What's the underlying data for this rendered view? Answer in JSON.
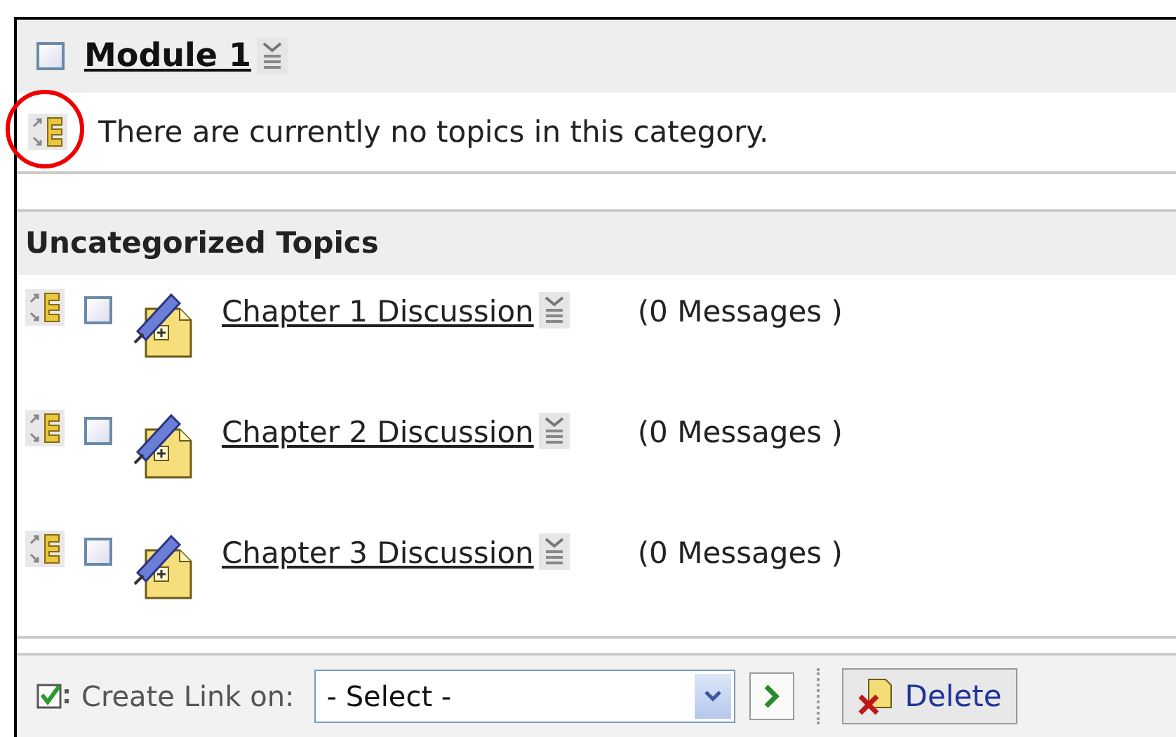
{
  "category": {
    "title": "Module 1",
    "checked": false,
    "empty_message": "There are currently no topics in this category."
  },
  "uncategorized": {
    "heading": "Uncategorized Topics",
    "topics": [
      {
        "title": "Chapter 1 Discussion",
        "checked": false,
        "count": "(0 Messages )"
      },
      {
        "title": "Chapter 2 Discussion",
        "checked": false,
        "count": "(0 Messages )"
      },
      {
        "title": "Chapter 3 Discussion",
        "checked": false,
        "count": "(0 Messages )"
      }
    ]
  },
  "toolbar": {
    "create_link_label": "Create Link on:",
    "select_value": "- Select -",
    "delete_label": "Delete"
  }
}
